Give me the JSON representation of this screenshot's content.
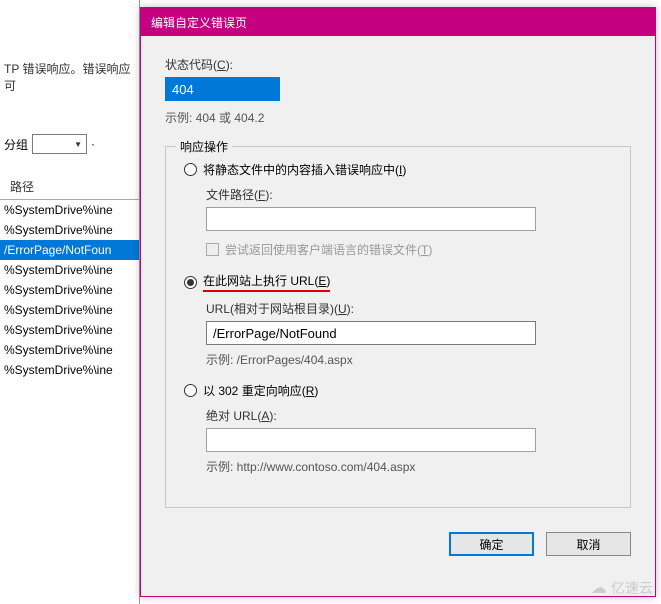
{
  "bg": {
    "intro": "TP 错误响应。错误响应可",
    "groupLabel": "分组",
    "groupDot": "·",
    "listHeader": "路径",
    "rows": [
      "%SystemDrive%\\ine",
      "%SystemDrive%\\ine",
      "/ErrorPage/NotFoun",
      "%SystemDrive%\\ine",
      "%SystemDrive%\\ine",
      "%SystemDrive%\\ine",
      "%SystemDrive%\\ine",
      "%SystemDrive%\\ine",
      "%SystemDrive%\\ine"
    ],
    "selectedIndex": 2
  },
  "dialog": {
    "title": "编辑自定义错误页",
    "statusLabel": "状态代码",
    "statusKey": "C",
    "statusValue": "404",
    "statusExample": "示例: 404 或 404.2",
    "responseLegend": "响应操作",
    "opt1": "将静态文件中的内容插入错误响应中",
    "opt1Key": "I",
    "filePathLabel": "文件路径",
    "filePathKey": "F",
    "filePathValue": "",
    "tryReturn": "尝试返回使用客户端语言的错误文件",
    "tryReturnKey": "T",
    "opt2": "在此网站上执行 URL",
    "opt2Key": "E",
    "urlRelLabel": "URL(相对于网站根目录)",
    "urlRelKey": "U",
    "urlRelValue": "/ErrorPage/NotFound",
    "urlRelExample": "示例: /ErrorPages/404.aspx",
    "opt3": "以 302 重定向响应",
    "opt3Key": "R",
    "urlAbsLabel": "绝对 URL",
    "urlAbsKey": "A",
    "urlAbsValue": "",
    "urlAbsExample": "示例: http://www.contoso.com/404.aspx",
    "ok": "确定",
    "cancel": "取消"
  },
  "watermark": "亿速云"
}
